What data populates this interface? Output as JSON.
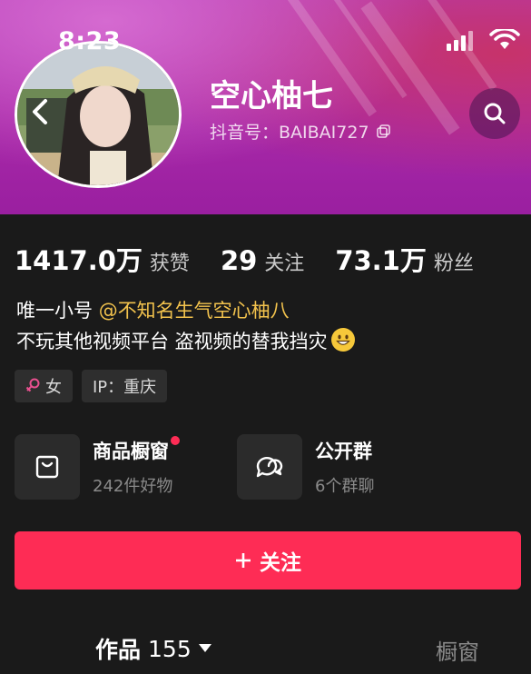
{
  "status_bar": {
    "time": "8:23"
  },
  "profile": {
    "name": "空心柚七",
    "douyin_id": "抖音号：BAIBAI727"
  },
  "stats": [
    {
      "value": "1417.0万",
      "label": "获赞"
    },
    {
      "value": "29",
      "label": "关注"
    },
    {
      "value": "73.1万",
      "label": "粉丝"
    }
  ],
  "bio": {
    "line1_prefix": "唯一小号 ",
    "line1_mention": "@不知名生气空心柚八",
    "line2": "不玩其他视频平台 盗视频的替我挡灾"
  },
  "tags": [
    {
      "icon": "female-icon",
      "label": "女",
      "icon_color": "#e8508f"
    },
    {
      "label": "IP：重庆"
    }
  ],
  "features": [
    {
      "icon": "shopping-bag-icon",
      "title": "商品橱窗",
      "subtitle": "242件好物",
      "has_dot": true
    },
    {
      "icon": "chat-bubbles-icon",
      "title": "公开群",
      "subtitle": "6个群聊",
      "has_dot": false
    }
  ],
  "follow_button": {
    "icon": "plus-icon",
    "label": "关注"
  },
  "tabs": {
    "works_label": "作品",
    "works_count": "155",
    "shop_label": "橱窗"
  },
  "colors": {
    "accent": "#fe2c55",
    "mention": "#f3c34d",
    "header_gradient": [
      "#d56ad0",
      "#a92aa9",
      "#c7336a"
    ],
    "background": "#1a1a1a"
  }
}
